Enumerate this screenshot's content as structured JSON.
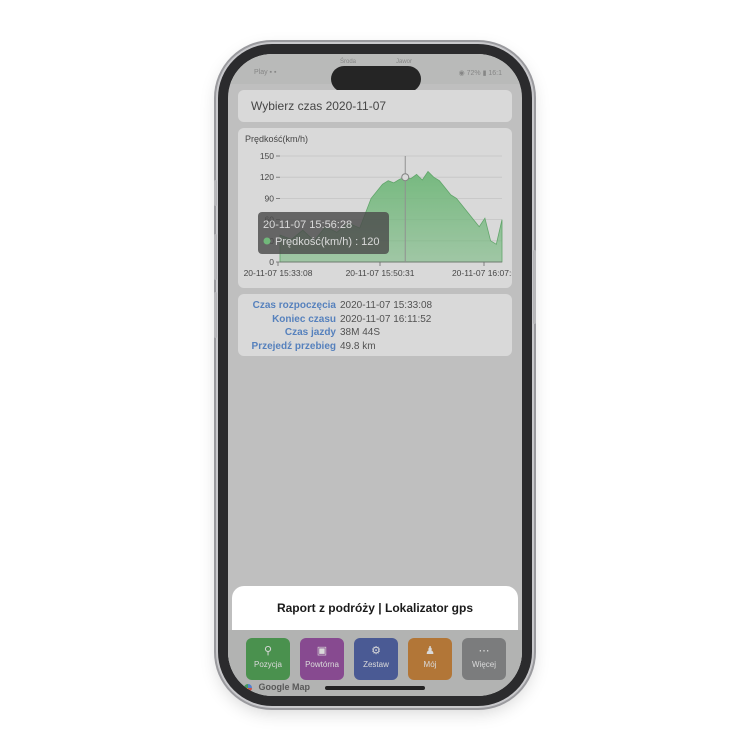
{
  "status_bar": {
    "left_text": "Play ▪ ▪",
    "carrier_1": "Środa",
    "carrier_2": "Jawor",
    "right_text": "◉ 72% ▮ 16:1"
  },
  "date_picker": {
    "label": "Wybierz czas 2020-11-07"
  },
  "chart_data": {
    "type": "area",
    "title": "Prędkość(km/h)",
    "ylabel": "Prędkość(km/h)",
    "ylim": [
      0,
      150
    ],
    "yticks": [
      "150",
      "120",
      "90",
      "60",
      "30",
      "0"
    ],
    "xtick_labels": [
      "20-11-07 15:33:08",
      "20-11-07 15:50:31",
      "20-11-07 16:07:5"
    ],
    "grid": true,
    "color": "#6fd17c",
    "series": [
      {
        "x_minutes": [
          0,
          2,
          4,
          6,
          8,
          10,
          12,
          14,
          16,
          18,
          19,
          20,
          21,
          22,
          23,
          24,
          25,
          26,
          27,
          28,
          29,
          30,
          31,
          32,
          33,
          34,
          35,
          36,
          37,
          38,
          39
        ],
        "values": [
          38,
          32,
          45,
          30,
          50,
          42,
          55,
          48,
          90,
          110,
          115,
          112,
          117,
          120,
          118,
          124,
          116,
          128,
          120,
          115,
          105,
          95,
          90,
          80,
          70,
          60,
          50,
          62,
          30,
          25,
          60
        ]
      }
    ],
    "tooltip": {
      "time": "20-11-07 15:56:28",
      "series_label": "Prędkość(km/h) : 120"
    }
  },
  "trip_info": {
    "rows": [
      {
        "label": "Czas rozpoczęcia",
        "value": "2020-11-07 15:33:08"
      },
      {
        "label": "Koniec czasu",
        "value": "2020-11-07 16:11:52"
      },
      {
        "label": "Czas jazdy",
        "value": "38M 44S"
      },
      {
        "label": "Przejedź przebieg",
        "value": "49.8 km"
      }
    ]
  },
  "sheet_title": "Raport z podróży | Lokalizator gps",
  "tabbar": {
    "tabs": [
      {
        "label": "Pozycja",
        "color": "#3a9b3f",
        "icon": "pin-icon"
      },
      {
        "label": "Powtórna",
        "color": "#8e3a9a",
        "icon": "playback-icon"
      },
      {
        "label": "Zestaw",
        "color": "#3a4fa0",
        "icon": "gear-icon"
      },
      {
        "label": "Mój",
        "color": "#c9761f",
        "icon": "person-icon"
      },
      {
        "label": "Więcej",
        "color": "#7d7f80",
        "icon": "more-icon"
      }
    ],
    "map_label": "Google Map"
  }
}
